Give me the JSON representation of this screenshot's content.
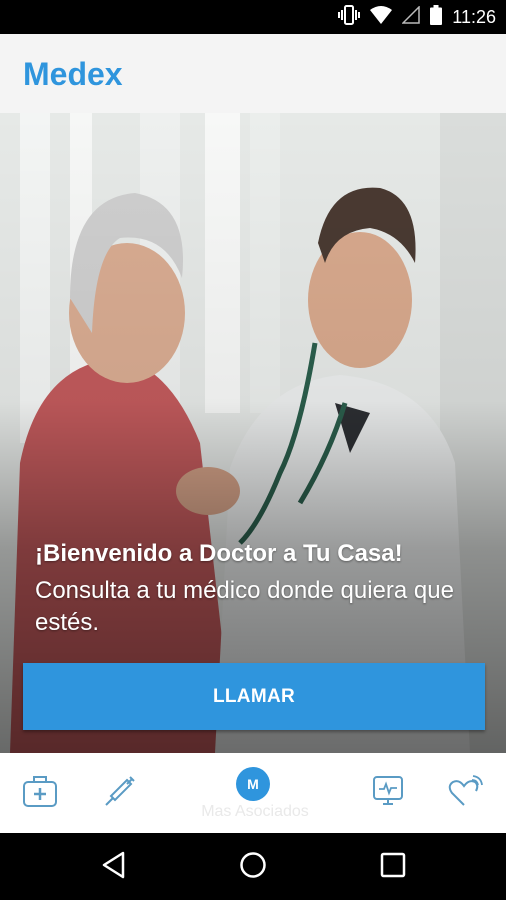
{
  "status_bar": {
    "time": "11:26",
    "icons": [
      "vibrate-icon",
      "wifi-icon",
      "signal-icon",
      "battery-icon"
    ]
  },
  "app_bar": {
    "title": "Medex"
  },
  "hero": {
    "welcome": "¡Bienvenido a Doctor a Tu Casa!",
    "subtitle": "Consulta a tu médico donde quiera que estés.",
    "call_button": "LLAMAR"
  },
  "bottom_nav": {
    "items": [
      {
        "icon": "medical-kit-icon"
      },
      {
        "icon": "syringe-icon"
      },
      {
        "icon": "medex-logo",
        "logo_text": "M",
        "label": "Mas Asociados"
      },
      {
        "icon": "monitor-icon"
      },
      {
        "icon": "heart-wireless-icon"
      }
    ]
  },
  "system_nav": {
    "buttons": [
      "back-icon",
      "home-icon",
      "recents-icon"
    ]
  },
  "colors": {
    "accent": "#2f95dd",
    "app_bar_bg": "#f4f4f4",
    "icon_color": "#5a9bc4"
  }
}
